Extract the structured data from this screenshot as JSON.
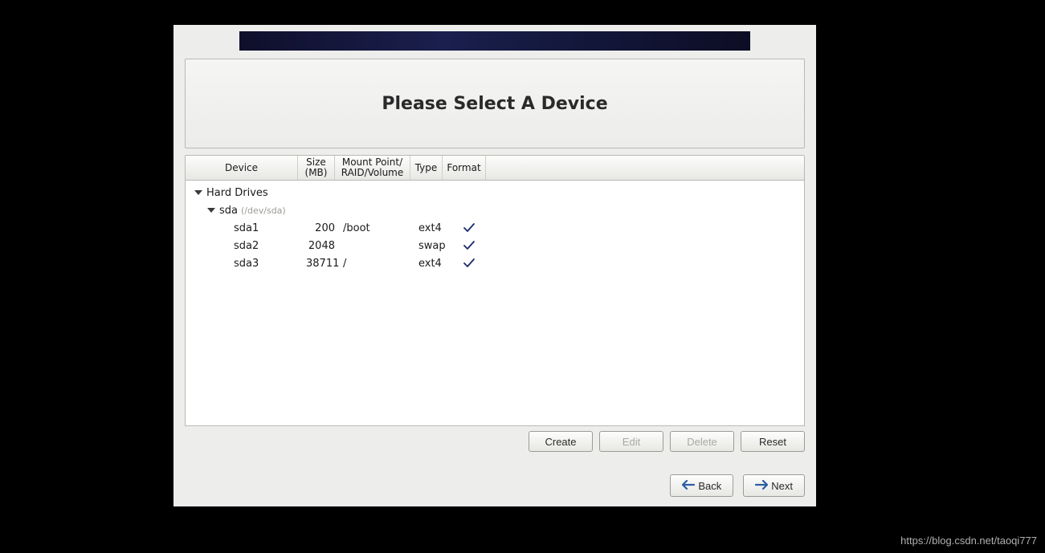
{
  "title": "Please Select A Device",
  "columns": {
    "device": "Device",
    "size": "Size\n(MB)",
    "mount": "Mount Point/\nRAID/Volume",
    "type": "Type",
    "format": "Format"
  },
  "tree": {
    "root_label": "Hard Drives",
    "disk": {
      "name": "sda",
      "path": "(/dev/sda)"
    },
    "partitions": [
      {
        "name": "sda1",
        "size": "200",
        "mount": "/boot",
        "type": "ext4",
        "format": true
      },
      {
        "name": "sda2",
        "size": "2048",
        "mount": "",
        "type": "swap",
        "format": true
      },
      {
        "name": "sda3",
        "size": "38711",
        "mount": "/",
        "type": "ext4",
        "format": true
      }
    ]
  },
  "buttons": {
    "create": "Create",
    "edit": "Edit",
    "delete": "Delete",
    "reset": "Reset",
    "back": "Back",
    "next": "Next"
  },
  "watermark": "https://blog.csdn.net/taoqi777"
}
